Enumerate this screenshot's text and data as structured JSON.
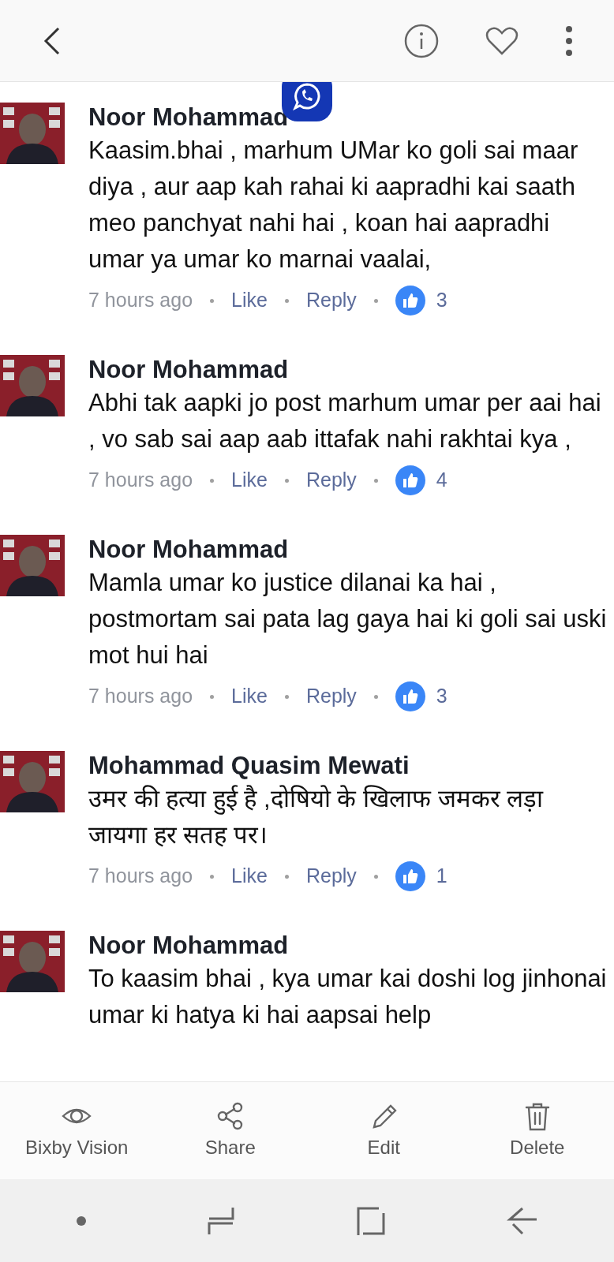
{
  "comments": [
    {
      "author": "Noor Mohammad",
      "text": "Kaasim.bhai , marhum UMar ko goli sai maar diya , aur aap kah rahai ki aapradhi kai saath meo panchyat nahi hai , koan hai aapradhi umar ya umar ko marnai vaalai,",
      "time": "7 hours ago",
      "like": "Like",
      "reply": "Reply",
      "reactions": "3"
    },
    {
      "author": "Noor Mohammad",
      "text": "Abhi tak aapki jo post marhum umar per aai hai , vo sab sai aap aab ittafak nahi rakhtai kya ,",
      "time": "7 hours ago",
      "like": "Like",
      "reply": "Reply",
      "reactions": "4"
    },
    {
      "author": "Noor Mohammad",
      "text": "Mamla umar ko justice dilanai ka hai , postmortam sai pata lag gaya hai ki goli sai uski mot hui hai",
      "time": "7 hours ago",
      "like": "Like",
      "reply": "Reply",
      "reactions": "3"
    },
    {
      "author": "Mohammad Quasim Mewati",
      "text": "उमर की हत्या हुई है ,दोषियो के खिलाफ जमकर लड़ा जायगा हर सतह पर।",
      "time": "7 hours ago",
      "like": "Like",
      "reply": "Reply",
      "reactions": "1"
    },
    {
      "author": "Noor Mohammad",
      "text": "To kaasim bhai , kya umar kai doshi log jinhonai umar ki hatya ki hai aapsai help"
    }
  ],
  "toolbar": [
    {
      "kind": "vision",
      "label": "Bixby Vision"
    },
    {
      "kind": "share",
      "label": "Share"
    },
    {
      "kind": "edit",
      "label": "Edit"
    },
    {
      "kind": "delete",
      "label": "Delete"
    }
  ]
}
